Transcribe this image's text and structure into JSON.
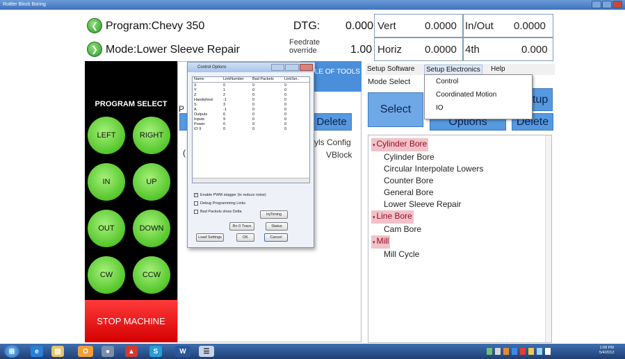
{
  "window": {
    "title": "Rottler Block Boring"
  },
  "header": {
    "program_label": "Program:Chevy 350",
    "mode_label": "Mode:Lower Sleeve Repair",
    "dtg_label": "DTG:",
    "dtg_value": "0.000",
    "feedrate_label": "Feedrate override",
    "feedrate_value": "1.00",
    "vert_label": "Vert",
    "vert_value": "0.0000",
    "inout_label": "In/Out",
    "inout_value": "0.0000",
    "horiz_label": "Horiz",
    "horiz_value": "0.0000",
    "fourth_label": "4th",
    "fourth_value": "0.000"
  },
  "left_panel": {
    "program_select": "PROGRAM SELECT",
    "buttons": [
      "LEFT",
      "RIGHT",
      "IN",
      "UP",
      "OUT",
      "DOWN",
      "CW",
      "CCW"
    ],
    "stop": "STOP MACHINE"
  },
  "center": {
    "tables_button": "TABLE OF TOOLS",
    "partial_label": "P",
    "delete_button": "Delete",
    "tools_config": "yls Config",
    "vblock": "VBlock",
    "partial_c": "("
  },
  "menu": {
    "items": [
      "Setup Software",
      "Setup Electronics",
      "Help"
    ],
    "dropdown": [
      "Control",
      "Coordinated Motion",
      "IO"
    ]
  },
  "right": {
    "mode_select": "Mode Select",
    "select_button": "Select",
    "options_button": "Options",
    "delete_button": "Delete",
    "setup_partial": "tup",
    "tree": [
      {
        "label": "Cylinder Bore",
        "cat": true
      },
      {
        "label": "Cylinder Bore",
        "cat": false
      },
      {
        "label": "Circular Interpolate Lowers",
        "cat": false
      },
      {
        "label": "Counter Bore",
        "cat": false
      },
      {
        "label": "General Bore",
        "cat": false
      },
      {
        "label": "Lower Sleeve Repair",
        "cat": false
      },
      {
        "label": "Line Bore",
        "cat": true
      },
      {
        "label": "Cam Bore",
        "cat": false
      },
      {
        "label": "Mill",
        "cat": true
      },
      {
        "label": "Mill Cycle",
        "cat": false
      }
    ]
  },
  "dialog": {
    "title": "Control Options",
    "columns": [
      "Name",
      "LinkNumber",
      "Bad Packets",
      "LinkSer.."
    ],
    "rows": [
      [
        "X",
        "0",
        "0",
        "0"
      ],
      [
        "Y",
        "1",
        "0",
        "0"
      ],
      [
        "Z",
        "2",
        "0",
        "0"
      ],
      [
        "Handwheel",
        "-1",
        "0",
        "0"
      ],
      [
        "S",
        "3",
        "0",
        "0"
      ],
      [
        "A",
        "-1",
        "0",
        "0"
      ],
      [
        "Outputs",
        "6",
        "0",
        "0"
      ],
      [
        "Inputs",
        "9",
        "0",
        "0"
      ],
      [
        "Power",
        "0",
        "0",
        "0"
      ],
      [
        "IO 9",
        "0",
        "0",
        "0"
      ]
    ],
    "checkbox_1": "Enable PWM stagger (to reduce noise)",
    "checkbox_2": "Debug Programming Links",
    "checkbox_3": "Bad Packets show Delta",
    "btn_injtiming": "InjTiming",
    "btn_rn_trace": "Rn 0 Trace",
    "btn_status": "Status",
    "btn_load": "Load Settings",
    "btn_ok": "OK",
    "btn_cancel": "Cancel"
  },
  "taskbar": {
    "time": "1:08 PM",
    "date": "5/4/2012"
  }
}
